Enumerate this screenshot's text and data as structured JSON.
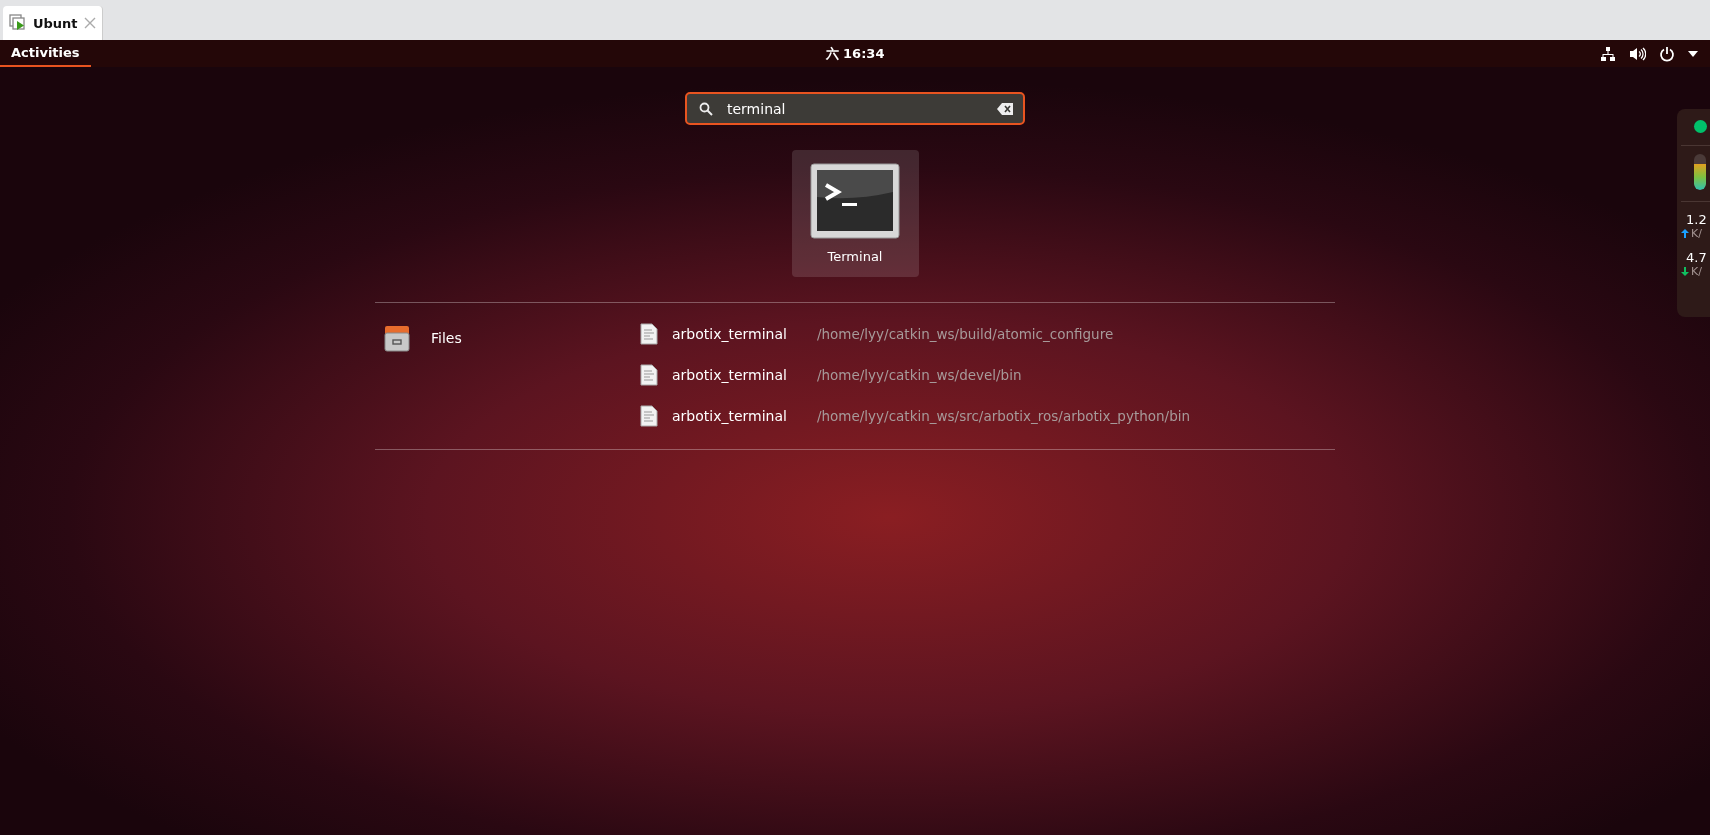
{
  "browser_tab": {
    "title": "Ubunt"
  },
  "top_bar": {
    "activities": {
      "label": "Activities",
      "selected": true
    },
    "clock": "六 16:34"
  },
  "search": {
    "value": "terminal"
  },
  "apps": [
    {
      "name": "Terminal",
      "selected": true
    }
  ],
  "providers": [
    {
      "name": "Files",
      "results": [
        {
          "name": "arbotix_terminal",
          "path": "/home/lyy/catkin_ws/build/atomic_configure"
        },
        {
          "name": "arbotix_terminal",
          "path": "/home/lyy/catkin_ws/devel/bin"
        },
        {
          "name": "arbotix_terminal",
          "path": "/home/lyy/catkin_ws/src/arbotix_ros/arbotix_python/bin"
        }
      ]
    }
  ],
  "monitor": {
    "color": "#00c06a",
    "level": 0.72,
    "rates": [
      {
        "kind": "up",
        "value": "1.2",
        "unit": "K/"
      },
      {
        "kind": "down",
        "value": "4.7",
        "unit": "K/"
      }
    ]
  }
}
